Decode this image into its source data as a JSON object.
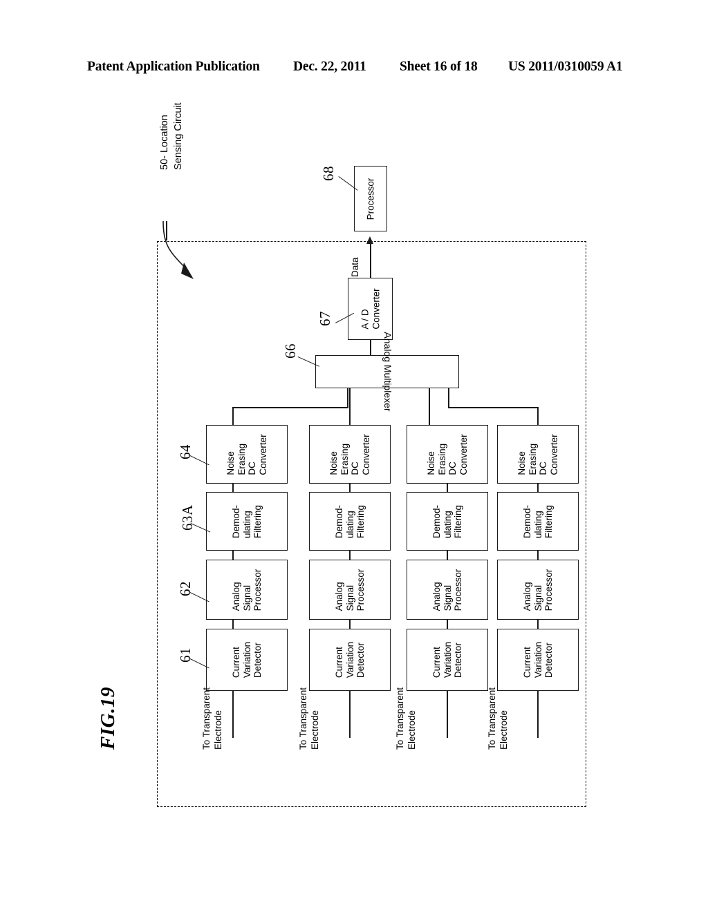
{
  "header": {
    "publication": "Patent Application Publication",
    "date": "Dec. 22, 2011",
    "sheet": "Sheet 16 of 18",
    "patent_number": "US 2011/0310059 A1"
  },
  "figure": {
    "title": "FIG.19",
    "callout": {
      "line1": "50- Location",
      "line2": "Sensing Circuit"
    },
    "data_label": "Data",
    "processor": {
      "ref": "68",
      "label": "Processor"
    },
    "ad_converter": {
      "ref": "67",
      "line1": "A / D",
      "line2": "Converter"
    },
    "multiplexer": {
      "ref": "66",
      "label": "Analog Multiplexer"
    },
    "stage_refs": {
      "noise_erasing": "64",
      "demodulating": "63A",
      "analog_signal": "62",
      "current_variation": "61"
    },
    "stages": [
      {
        "name": "noise-erasing-dc-converter",
        "lines": [
          "Noise",
          "Erasing",
          "DC",
          "Converter"
        ]
      },
      {
        "name": "demodulating-filtering",
        "lines": [
          "Demod-",
          "ulating",
          "Filtering"
        ]
      },
      {
        "name": "analog-signal-processor",
        "lines": [
          "Analog",
          "Signal",
          "Processor"
        ]
      },
      {
        "name": "current-variation-detector",
        "lines": [
          "Current",
          "Variation",
          "Detector"
        ]
      }
    ],
    "electrode_label": {
      "line1": "To Transparent",
      "line2": "Electrode"
    },
    "channels": 4,
    "colors": {
      "ink": "#1a1a1a",
      "paper": "#ffffff"
    }
  }
}
